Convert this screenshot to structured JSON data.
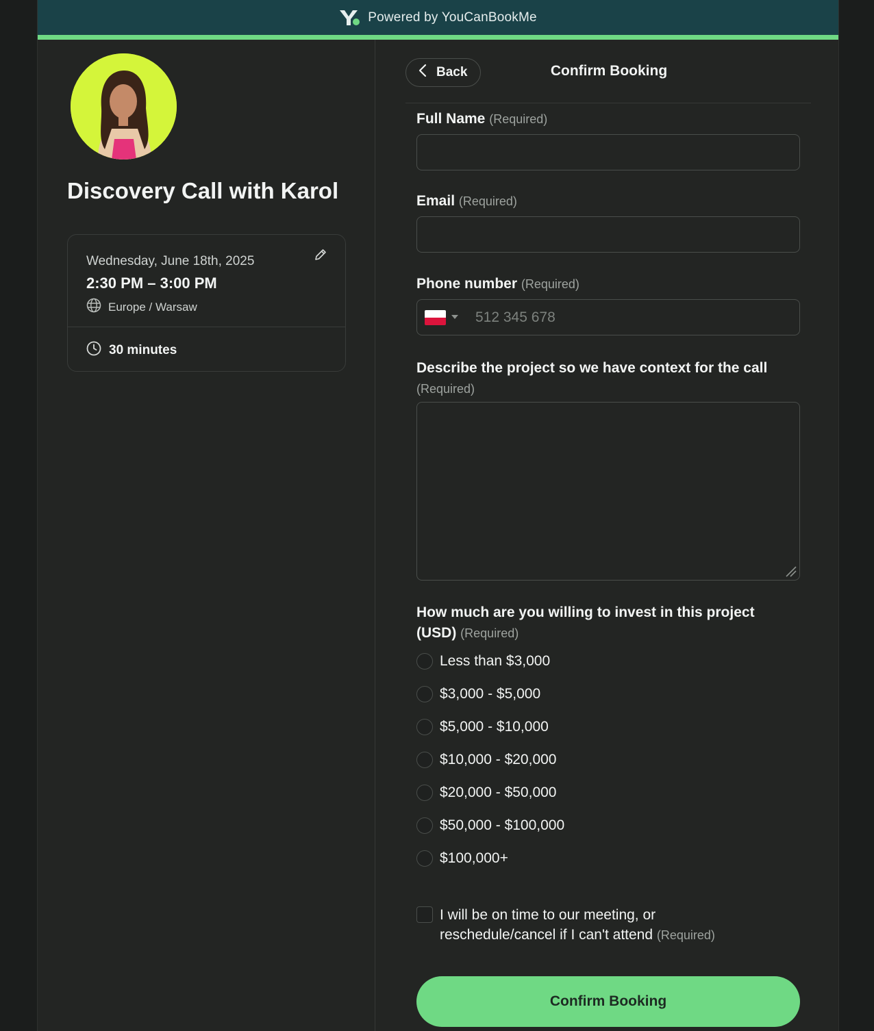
{
  "topbar": {
    "brand_text": "Powered by YouCanBookMe",
    "logo_icon": "youcanbookme-logo"
  },
  "colors": {
    "topbar_bg": "#1a4248",
    "accent": "#6fd984",
    "panel_bg": "#232523",
    "page_bg": "#1b1d1c",
    "avatar_bg": "#d4f53a"
  },
  "event": {
    "title": "Discovery Call with Karol",
    "date": "Wednesday, June 18th, 2025",
    "time": "2:30 PM – 3:00 PM",
    "timezone": "Europe / Warsaw",
    "duration": "30 minutes"
  },
  "header": {
    "back_label": "Back",
    "title": "Confirm Booking"
  },
  "form": {
    "full_name": {
      "label": "Full Name",
      "required": "(Required)",
      "value": ""
    },
    "email": {
      "label": "Email",
      "required": "(Required)",
      "value": ""
    },
    "phone": {
      "label": "Phone number",
      "required": "(Required)",
      "placeholder": "512 345 678",
      "country": "PL"
    },
    "project": {
      "label": "Describe the project so we have context for the call",
      "required": "(Required)",
      "value": ""
    },
    "budget": {
      "label": "How much are you willing to invest in this project (USD)",
      "required": "(Required)",
      "options": [
        "Less than $3,000",
        "$3,000 - $5,000",
        "$5,000 - $10,000",
        "$10,000 - $20,000",
        "$20,000 - $50,000",
        "$50,000 - $100,000",
        "$100,000+"
      ]
    },
    "attendance": {
      "label": "I will be on time to our meeting, or reschedule/cancel if I can't attend",
      "required": "(Required)",
      "checked": false
    },
    "submit_label": "Confirm Booking"
  }
}
